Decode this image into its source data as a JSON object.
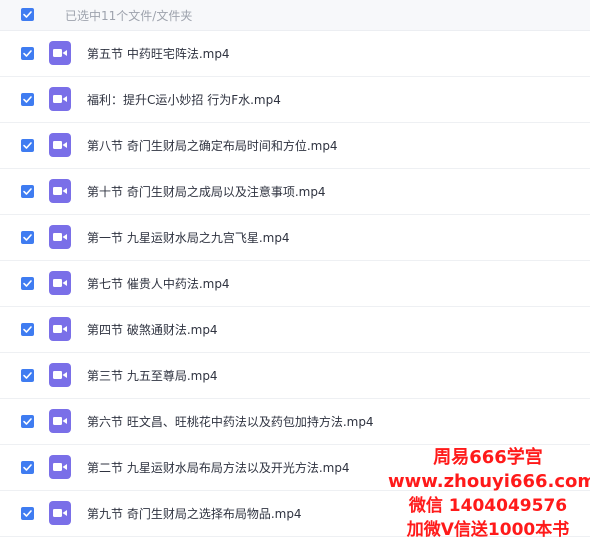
{
  "header": {
    "selection_text": "已选中11个文件/文件夹"
  },
  "files": [
    {
      "name": "第五节 中药旺宅阵法.mp4"
    },
    {
      "name": "福利：提升C运小妙招 行为F水.mp4"
    },
    {
      "name": "第八节 奇门生财局之确定布局时间和方位.mp4"
    },
    {
      "name": "第十节 奇门生财局之成局以及注意事项.mp4"
    },
    {
      "name": "第一节 九星运财水局之九宫飞星.mp4"
    },
    {
      "name": "第七节 催贵人中药法.mp4"
    },
    {
      "name": "第四节 破煞通财法.mp4"
    },
    {
      "name": "第三节 九五至尊局.mp4"
    },
    {
      "name": "第六节 旺文昌、旺桃花中药法以及药包加持方法.mp4"
    },
    {
      "name": "第二节 九星运财水局布局方法以及开光方法.mp4"
    },
    {
      "name": "第九节 奇门生财局之选择布局物品.mp4"
    }
  ],
  "watermark": {
    "line1": "周易666学宫",
    "line2": "www.zhouyi666.com",
    "line3": "微信 1404049576",
    "line4": "加微V信送1000本书"
  },
  "colors": {
    "checkbox": "#3f7cf1",
    "video_icon": "#7a6fe8",
    "watermark": "#ff1a1a"
  },
  "icons": {
    "checkbox": "checkmark-icon",
    "file": "video-file-icon"
  }
}
